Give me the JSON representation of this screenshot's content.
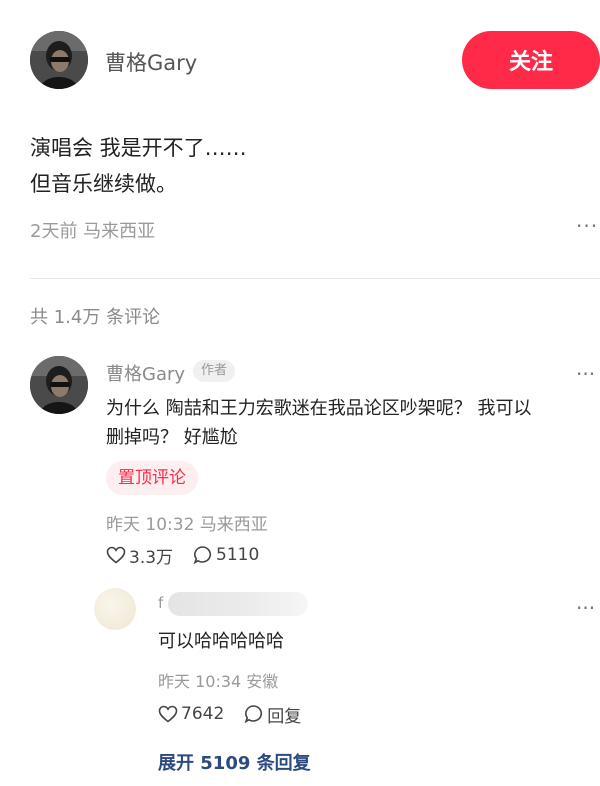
{
  "author": {
    "name": "曹格Gary",
    "follow_label": "关注"
  },
  "post": {
    "lines": [
      "演唱会 我是开不了……",
      "但音乐继续做。"
    ],
    "meta": "2天前 马来西亚",
    "more": "···"
  },
  "comments_header": "共 1.4万 条评论",
  "top_comment": {
    "name": "曹格Gary",
    "tag": "作者",
    "lines": [
      "为什么 陶喆和王力宏歌迷在我品论区吵架呢？ 我可以",
      "删掉吗？ 好尴尬"
    ],
    "pinned_label": "置顶评论",
    "meta": "昨天 10:32 马来西亚",
    "likes": "3.3万",
    "replies": "5110",
    "more": "···"
  },
  "reply": {
    "name_fragment": "f",
    "text": "可以哈哈哈哈哈",
    "meta": "昨天 10:34 安徽",
    "likes": "7642",
    "reply_label": "回复",
    "more": "···"
  },
  "expand_label": "展开 5109 条回复",
  "colors": {
    "accent": "#ff2a48",
    "link": "#2c4a80"
  }
}
